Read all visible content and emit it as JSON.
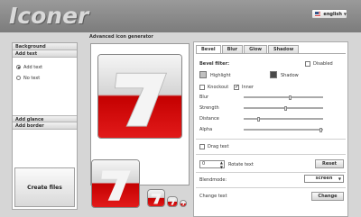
{
  "app": {
    "logo": "Iconer"
  },
  "language": {
    "selected": "english"
  },
  "sidebar": {
    "sections": [
      "Background",
      "Add text",
      "Add glance",
      "Add border"
    ],
    "text_options": [
      {
        "label": "Add text",
        "selected": true
      },
      {
        "label": "No text",
        "selected": false
      }
    ],
    "create_button": "Create files"
  },
  "main": {
    "title": "Advanced icon generator",
    "icon_glyph": "7"
  },
  "tabs": [
    "Bevel",
    "Blur",
    "Glow",
    "Shadow"
  ],
  "bevel": {
    "section_label": "Bevel filter:",
    "disabled_label": "Disabled",
    "disabled_checked": false,
    "highlight_label": "Highlight",
    "shadow_label": "Shadow",
    "knockout_label": "Knockout",
    "knockout_checked": false,
    "inner_label": "Inner",
    "inner_checked": true,
    "sliders": [
      {
        "label": "Blur",
        "value": 0.58
      },
      {
        "label": "Strength",
        "value": 0.52
      },
      {
        "label": "Distance",
        "value": 0.16
      },
      {
        "label": "Alpha",
        "value": 0.98
      }
    ]
  },
  "drag_text": {
    "label": "Drag text",
    "checked": false
  },
  "rotate": {
    "value": "0",
    "label": "Rotate text",
    "button": "Reset"
  },
  "blendmode": {
    "label": "Blendmode:",
    "value": "screen"
  },
  "change_text": {
    "label": "Change text",
    "button": "Change"
  },
  "colors": {
    "highlight": "#c0c0c0",
    "shadow": "#4a4a4a",
    "accent_red": "#d00000"
  }
}
